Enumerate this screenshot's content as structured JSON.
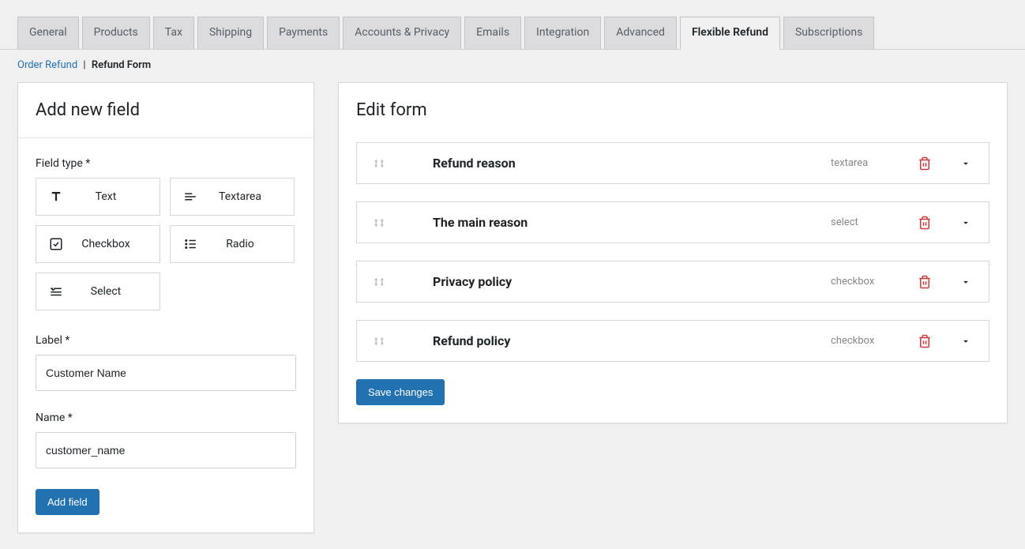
{
  "tabs": [
    {
      "label": "General",
      "active": false
    },
    {
      "label": "Products",
      "active": false
    },
    {
      "label": "Tax",
      "active": false
    },
    {
      "label": "Shipping",
      "active": false
    },
    {
      "label": "Payments",
      "active": false
    },
    {
      "label": "Accounts & Privacy",
      "active": false
    },
    {
      "label": "Emails",
      "active": false
    },
    {
      "label": "Integration",
      "active": false
    },
    {
      "label": "Advanced",
      "active": false
    },
    {
      "label": "Flexible Refund",
      "active": true
    },
    {
      "label": "Subscriptions",
      "active": false
    }
  ],
  "breadcrumb": {
    "link": "Order Refund",
    "current": "Refund Form"
  },
  "add_panel": {
    "title": "Add new field",
    "field_type_label": "Field type *",
    "types": {
      "text": "Text",
      "textarea": "Textarea",
      "checkbox": "Checkbox",
      "radio": "Radio",
      "select": "Select"
    },
    "label_label": "Label *",
    "label_value": "Customer Name",
    "name_label": "Name *",
    "name_value": "customer_name",
    "add_button": "Add field"
  },
  "edit_panel": {
    "title": "Edit form",
    "items": [
      {
        "title": "Refund reason",
        "type": "textarea"
      },
      {
        "title": "The main reason",
        "type": "select"
      },
      {
        "title": "Privacy policy",
        "type": "checkbox"
      },
      {
        "title": "Refund policy",
        "type": "checkbox"
      }
    ],
    "save_button": "Save changes"
  }
}
